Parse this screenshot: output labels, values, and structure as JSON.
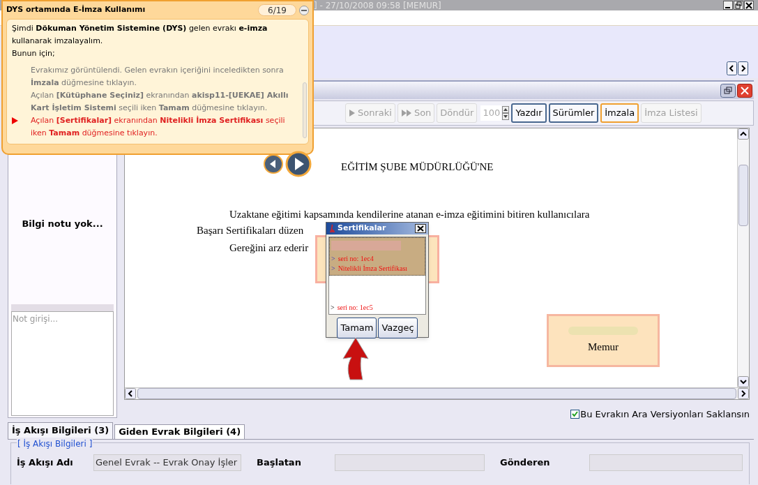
{
  "window": {
    "title": "] - 27/10/2008 09:58 [MEMUR]"
  },
  "toolbar": [
    {
      "kind": "play",
      "label": "Sonraki",
      "disabled": true,
      "focused": false
    },
    {
      "kind": "fastforward",
      "label": "Son",
      "disabled": true,
      "focused": false
    },
    {
      "kind": "button",
      "label": "Döndür",
      "disabled": true,
      "focused": false
    },
    {
      "kind": "spinner",
      "label": "100",
      "disabled": true
    },
    {
      "kind": "button",
      "label": "Yazdır",
      "disabled": false,
      "focused": false
    },
    {
      "kind": "button",
      "label": "Sürümler",
      "disabled": false,
      "focused": false
    },
    {
      "kind": "button",
      "label": "İmzala",
      "disabled": false,
      "focused": true
    },
    {
      "kind": "button",
      "label": "İmza Listesi",
      "disabled": true,
      "focused": false
    }
  ],
  "info_panel": {
    "message": "Bilgi notu yok...",
    "note_placeholder": "Not girişi..."
  },
  "document": {
    "heading": "EĞİTİM ŞUBE MÜDÜRLÜĞÜ'NE",
    "lines": [
      "Uzaktane eğitimi kapsamında kendilerine atanan e-imza eğitimini bitiren kullanıcılara",
      "Başarı Sertifikaları düzen",
      "Gereğini arz ederir"
    ],
    "signature": "Memur"
  },
  "keep_versions": {
    "label": "Bu Evrakın Ara Versiyonları Saklansın",
    "checked": true
  },
  "tabs": [
    {
      "label": "İş Akışı Bilgileri (3)",
      "selected": true
    },
    {
      "label": "Giden Evrak Bilgileri (4)",
      "selected": false
    }
  ],
  "workflow": {
    "legend": "[ İş Akışı Bilgileri ]",
    "fields": [
      {
        "label": "İş Akışı Adı",
        "value": "Genel Evrak -- Evrak Onay İşler"
      },
      {
        "label": "Başlatan"
      },
      {
        "label": "Gönderen"
      }
    ]
  },
  "tutorial": {
    "title": "DYS ortamında E-İmza Kullanımı",
    "counter": "6/19",
    "intro": [
      "Şimdi **Dökuman Yönetim Sistemine (DYS)** gelen evrakı **e-imza** kullanarak imzalayalım.",
      "Bunun için;"
    ],
    "steps": [
      {
        "text": "Evrakımız görüntülendi. Gelen evrakın içeriğini inceledikten sonra **İmzala** düğmesine tıklayın.",
        "current": false
      },
      {
        "text": "Açılan **[Kütüphane Seçiniz]** ekranından **akisp11-[UEKAE] Akıllı Kart İşletim Sistemi** seçili iken **Tamam** düğmesine tıklayın.",
        "current": false
      },
      {
        "text": "Açılan **[Sertifikalar]** ekranından **Nitelikli İmza Sertifikası** seçili iken **Tamam** düğmesine tıklayın.",
        "current": true
      }
    ]
  },
  "certificates_dialog": {
    "title": "Sertifikalar",
    "items": [
      {
        "selected": true,
        "lines": [
          {
            "marker": ">",
            "text": "seri no: 1ec4"
          },
          {
            "marker": ">",
            "text": "Nitelikli İmza Sertifikası"
          }
        ]
      },
      {
        "selected": false,
        "lines": [
          {
            "marker": ">",
            "text": "seri no: 1ec5"
          }
        ]
      }
    ],
    "buttons": [
      "Tamam",
      "Vazgeç"
    ]
  }
}
